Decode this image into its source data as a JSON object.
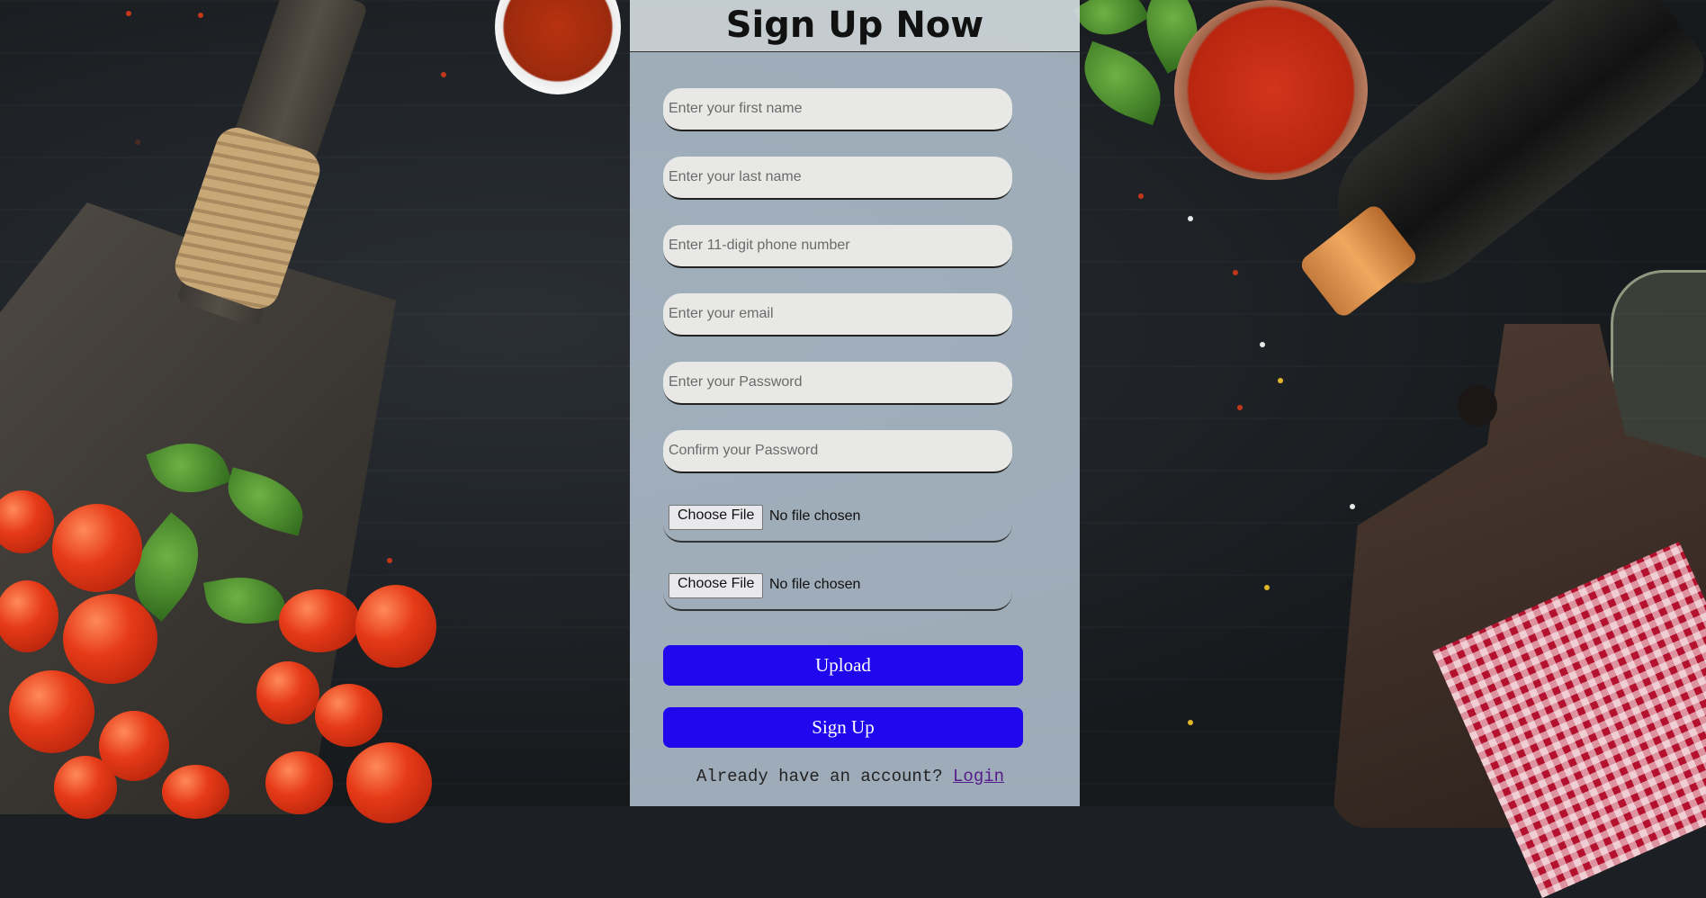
{
  "page": {
    "title": "Sign Up Now"
  },
  "form": {
    "fields": [
      {
        "placeholder": "Enter your first name",
        "value": ""
      },
      {
        "placeholder": "Enter your last name",
        "value": ""
      },
      {
        "placeholder": "Enter 11-digit phone number",
        "value": ""
      },
      {
        "placeholder": "Enter your email",
        "value": ""
      },
      {
        "placeholder": "Enter your Password",
        "value": ""
      },
      {
        "placeholder": "Confirm your Password",
        "value": ""
      }
    ],
    "files": [
      {
        "button_label": "Choose File",
        "status": "No file chosen"
      },
      {
        "button_label": "Choose File",
        "status": "No file chosen"
      }
    ],
    "upload_label": "Upload",
    "signup_label": "Sign Up",
    "login_prompt": "Already have an account?",
    "login_link": "Login"
  },
  "colors": {
    "primary_button": "#1f08ee",
    "panel_background": "#b4c4d2",
    "link": "#551a8b"
  }
}
